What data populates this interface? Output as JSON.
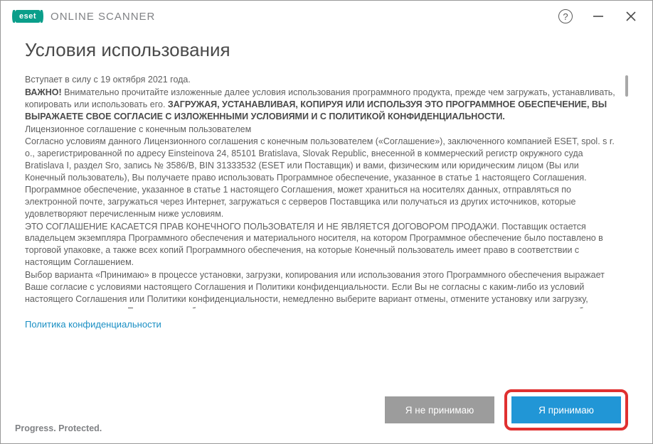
{
  "titlebar": {
    "brand_badge": "eset",
    "brand_text": "ONLINE SCANNER"
  },
  "page_title": "Условия использования",
  "terms": {
    "effective": "Вступает в силу с 19 октября 2021 года.",
    "important_label": "ВАЖНО!",
    "important_intro": " Внимательно прочитайте изложенные далее условия использования программного продукта, прежде чем загружать, устанавливать, копировать или использовать его. ",
    "important_bold": "ЗАГРУЖАЯ, УСТАНАВЛИВАЯ, КОПИРУЯ ИЛИ ИСПОЛЬЗУЯ ЭТО ПРОГРАММНОЕ ОБЕСПЕЧЕНИЕ, ВЫ ВЫРАЖАЕТЕ СВОЕ СОГЛАСИЕ С ИЗЛОЖЕННЫМИ УСЛОВИЯМИ И С ПОЛИТИКОЙ КОНФИДЕНЦИАЛЬНОСТИ.",
    "eula_heading": "Лицензионное соглашение с конечным пользователем",
    "p1": "Согласно условиям данного Лицензионного соглашения с конечным пользователем («Соглашение»), заключенного компанией ESET, spol. s r. o., зарегистрированной по адресу Einsteinova 24, 85101 Bratislava, Slovak Republic, внесенной в коммерческий регистр окружного суда Bratislava I, раздел Sro, запись № 3586/B, BIN 31333532 (ESET или Поставщик) и вами, физическим или юридическим лицом (Вы или Конечный пользователь), Вы получаете право использовать Программное обеспечение, указанное в статье 1 настоящего Соглашения. Программное обеспечение, указанное в статье 1 настоящего Соглашения, может храниться на носителях данных, отправляться по электронной почте, загружаться через Интернет, загружаться с серверов Поставщика или получаться из других источников, которые удовлетворяют перечисленным ниже условиям.",
    "p2": "ЭТО СОГЛАШЕНИЕ КАСАЕТСЯ ПРАВ КОНЕЧНОГО ПОЛЬЗОВАТЕЛЯ И НЕ ЯВЛЯЕТСЯ ДОГОВОРОМ ПРОДАЖИ. Поставщик остается владельцем экземпляра Программного обеспечения и материального носителя, на котором Программное обеспечение было поставлено в торговой упаковке, а также всех копий Программного обеспечения, на которые Конечный пользователь имеет право в соответствии с настоящим Соглашением.",
    "p3": "Выбор варианта «Принимаю» в процессе установки, загрузки, копирования или использования этого Программного обеспечения выражает Ваше согласие с условиями настоящего Соглашения и Политики конфиденциальности. Если Вы не согласны с каким-либо из условий настоящего Соглашения или Политики конфиденциальности, немедленно выберите вариант отмены, отмените установку или загрузку, уничтожьте или верните Программное обеспечение, установочные носители, сопроводительную документацию, а также квитанцию об оплате Поставщику или в организацию, в которой было приобретено Программное обеспечение."
  },
  "links": {
    "privacy": "Политика конфиденциальности"
  },
  "buttons": {
    "decline": "Я не принимаю",
    "accept": "Я принимаю"
  },
  "footer": "Progress. Protected."
}
